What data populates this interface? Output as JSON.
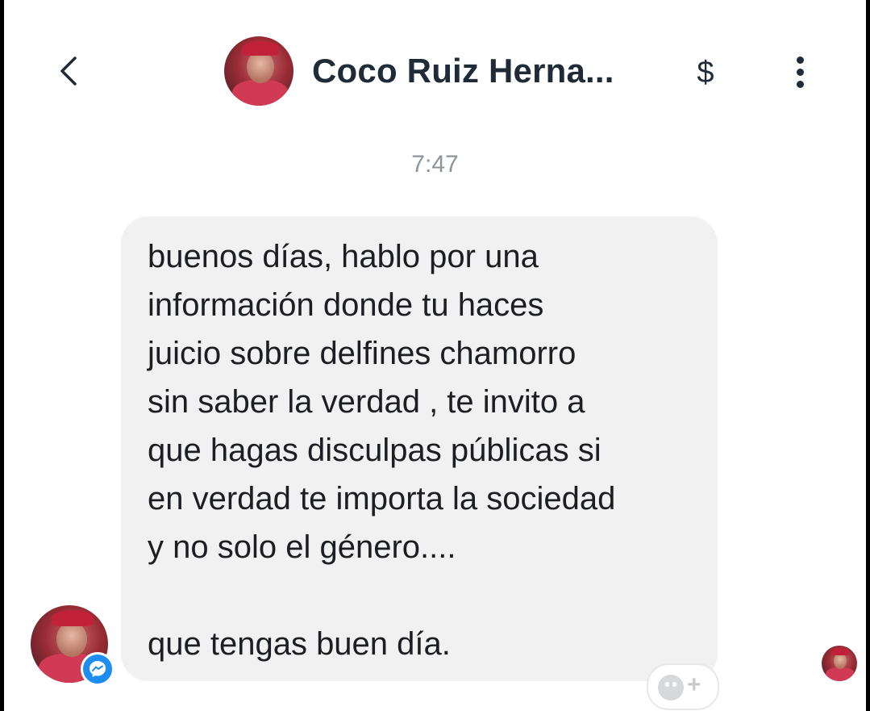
{
  "header": {
    "contact_name": "Coco Ruiz Herna...",
    "pay_symbol": "$",
    "icons": {
      "back": "chevron-left-icon",
      "avatar": "contact-avatar",
      "pay": "dollar-icon",
      "more": "more-vertical-icon"
    }
  },
  "conversation": {
    "timestamp": "7:47",
    "messages": [
      {
        "direction": "incoming",
        "text": "buenos días, hablo por una\ninformación donde tu haces\njuicio sobre delfines chamorro\nsin saber la verdad , te invito a\nque hagas disculpas públicas si\nen verdad te importa la sociedad\ny no solo el género....\n\nque tengas buen día."
      }
    ],
    "badge_icon": "messenger-icon",
    "reaction_icon": "add-reaction-icon",
    "reaction_symbol": "+"
  },
  "colors": {
    "bubble_bg": "#f1f1f2",
    "text": "#1c1e21",
    "header_text": "#1f2b36",
    "timestamp": "#8d949b",
    "messenger_blue": "#1d8df2"
  }
}
